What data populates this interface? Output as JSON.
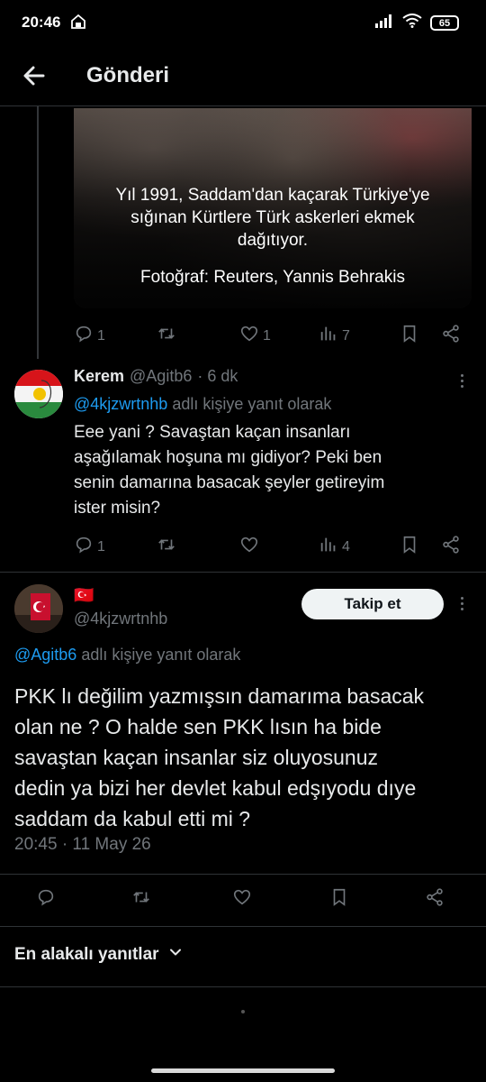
{
  "status_bar": {
    "time": "20:46",
    "battery": "65",
    "icons": [
      "notification-icon",
      "signal-icon",
      "wifi-icon",
      "battery-icon"
    ]
  },
  "header": {
    "title": "Gönderi"
  },
  "media": {
    "caption_lines": [
      "Yıl 1991, Saddam'dan kaçarak Türkiye'ye",
      "sığınan Kürtlere Türk askerleri ekmek",
      "dağıtıyor."
    ],
    "credit": "Fotoğraf: Reuters, Yannis Behrakis"
  },
  "parent_actions": {
    "replies": "1",
    "retweets": "",
    "likes": "1",
    "views": "7"
  },
  "reply_tweet": {
    "display_name": "Kerem",
    "handle": "@Agitb6",
    "time": "· 6 dk",
    "reply_to_mention": "@4kjzwrtnhb",
    "reply_to_suffix": " adlı kişiye yanıt olarak",
    "text_lines": [
      "Eee yani ? Savaştan kaçan insanları",
      "aşağılamak hoşuna mı gidiyor? Peki ben",
      "senin damarına basacak şeyler getireyim",
      "ister misin?"
    ],
    "replies": "1",
    "views": "4"
  },
  "main_tweet": {
    "flag": "🇹🇷",
    "handle": "@4kjzwrtnhb",
    "follow_label": "Takip et",
    "reply_to_mention": "@Agitb6",
    "reply_to_suffix": " adlı kişiye yanıt olarak",
    "text_lines": [
      "PKK lı değilim yazmışsın damarıma basacak",
      "olan ne ? O halde sen PKK lısın ha bide",
      "savaştan kaçan insanlar siz oluyosunuz",
      "dedin ya bizi her devlet kabul edşıyodu dıye",
      "saddam da kabul etti mi ?"
    ],
    "timestamp": "20:45 · 11 May 26"
  },
  "sort": {
    "label": "En alakalı yanıtlar"
  },
  "colors": {
    "background": "#000000",
    "text": "#e7e9ea",
    "muted": "#71767b",
    "link": "#1d9bf0",
    "divider": "#2f3336"
  }
}
